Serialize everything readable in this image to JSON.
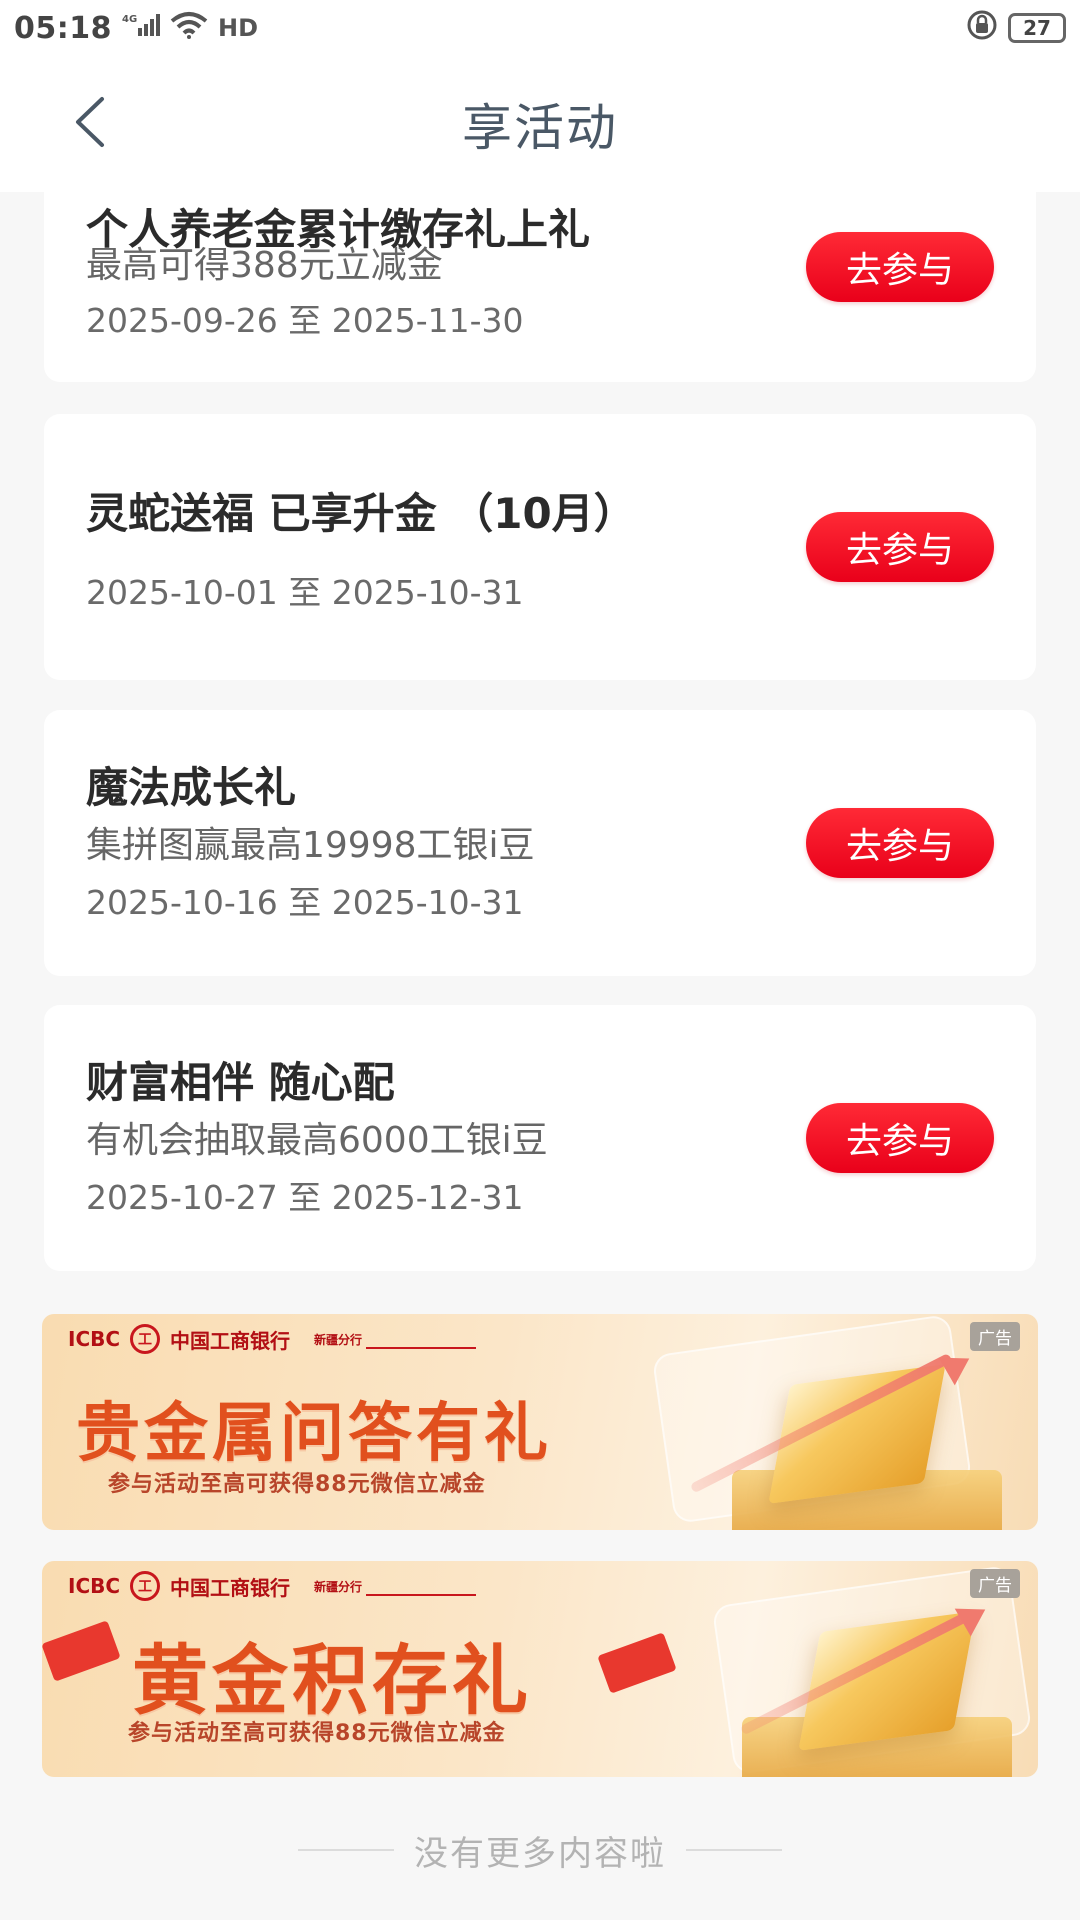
{
  "status_bar": {
    "time": "05:18",
    "network": "4G",
    "hd": "HD",
    "battery": "27"
  },
  "header": {
    "title": "享活动"
  },
  "activities": [
    {
      "title": "个人养老金累计缴存礼上礼",
      "desc": "最高可得388元立减金",
      "date": "2025-09-26 至 2025-11-30",
      "button": "去参与"
    },
    {
      "title": "灵蛇送福 已享升金 （10月）",
      "desc": "",
      "date": "2025-10-01 至 2025-10-31",
      "button": "去参与"
    },
    {
      "title": "魔法成长礼",
      "desc": "集拼图赢最高19998工银i豆",
      "date": "2025-10-16 至 2025-10-31",
      "button": "去参与"
    },
    {
      "title": "财富相伴 随心配",
      "desc": "有机会抽取最高6000工银i豆",
      "date": "2025-10-27 至 2025-12-31",
      "button": "去参与"
    }
  ],
  "banners": [
    {
      "brand_en": "ICBC",
      "brand_logo": "工",
      "brand_cn": "中国工商银行",
      "branch": "新疆分行",
      "ad_badge": "广告",
      "headline": "贵金属问答有礼",
      "sub": "参与活动至高可获得88元微信立减金"
    },
    {
      "brand_en": "ICBC",
      "brand_logo": "工",
      "brand_cn": "中国工商银行",
      "branch": "新疆分行",
      "ad_badge": "广告",
      "headline": "黄金积存礼",
      "sub": "参与活动至高可获得88元微信立减金"
    }
  ],
  "footer": {
    "text": "没有更多内容啦"
  },
  "colors": {
    "accent_red": "#e9001a",
    "title_text": "#4a5866",
    "banner_headline": "#e1501e"
  }
}
